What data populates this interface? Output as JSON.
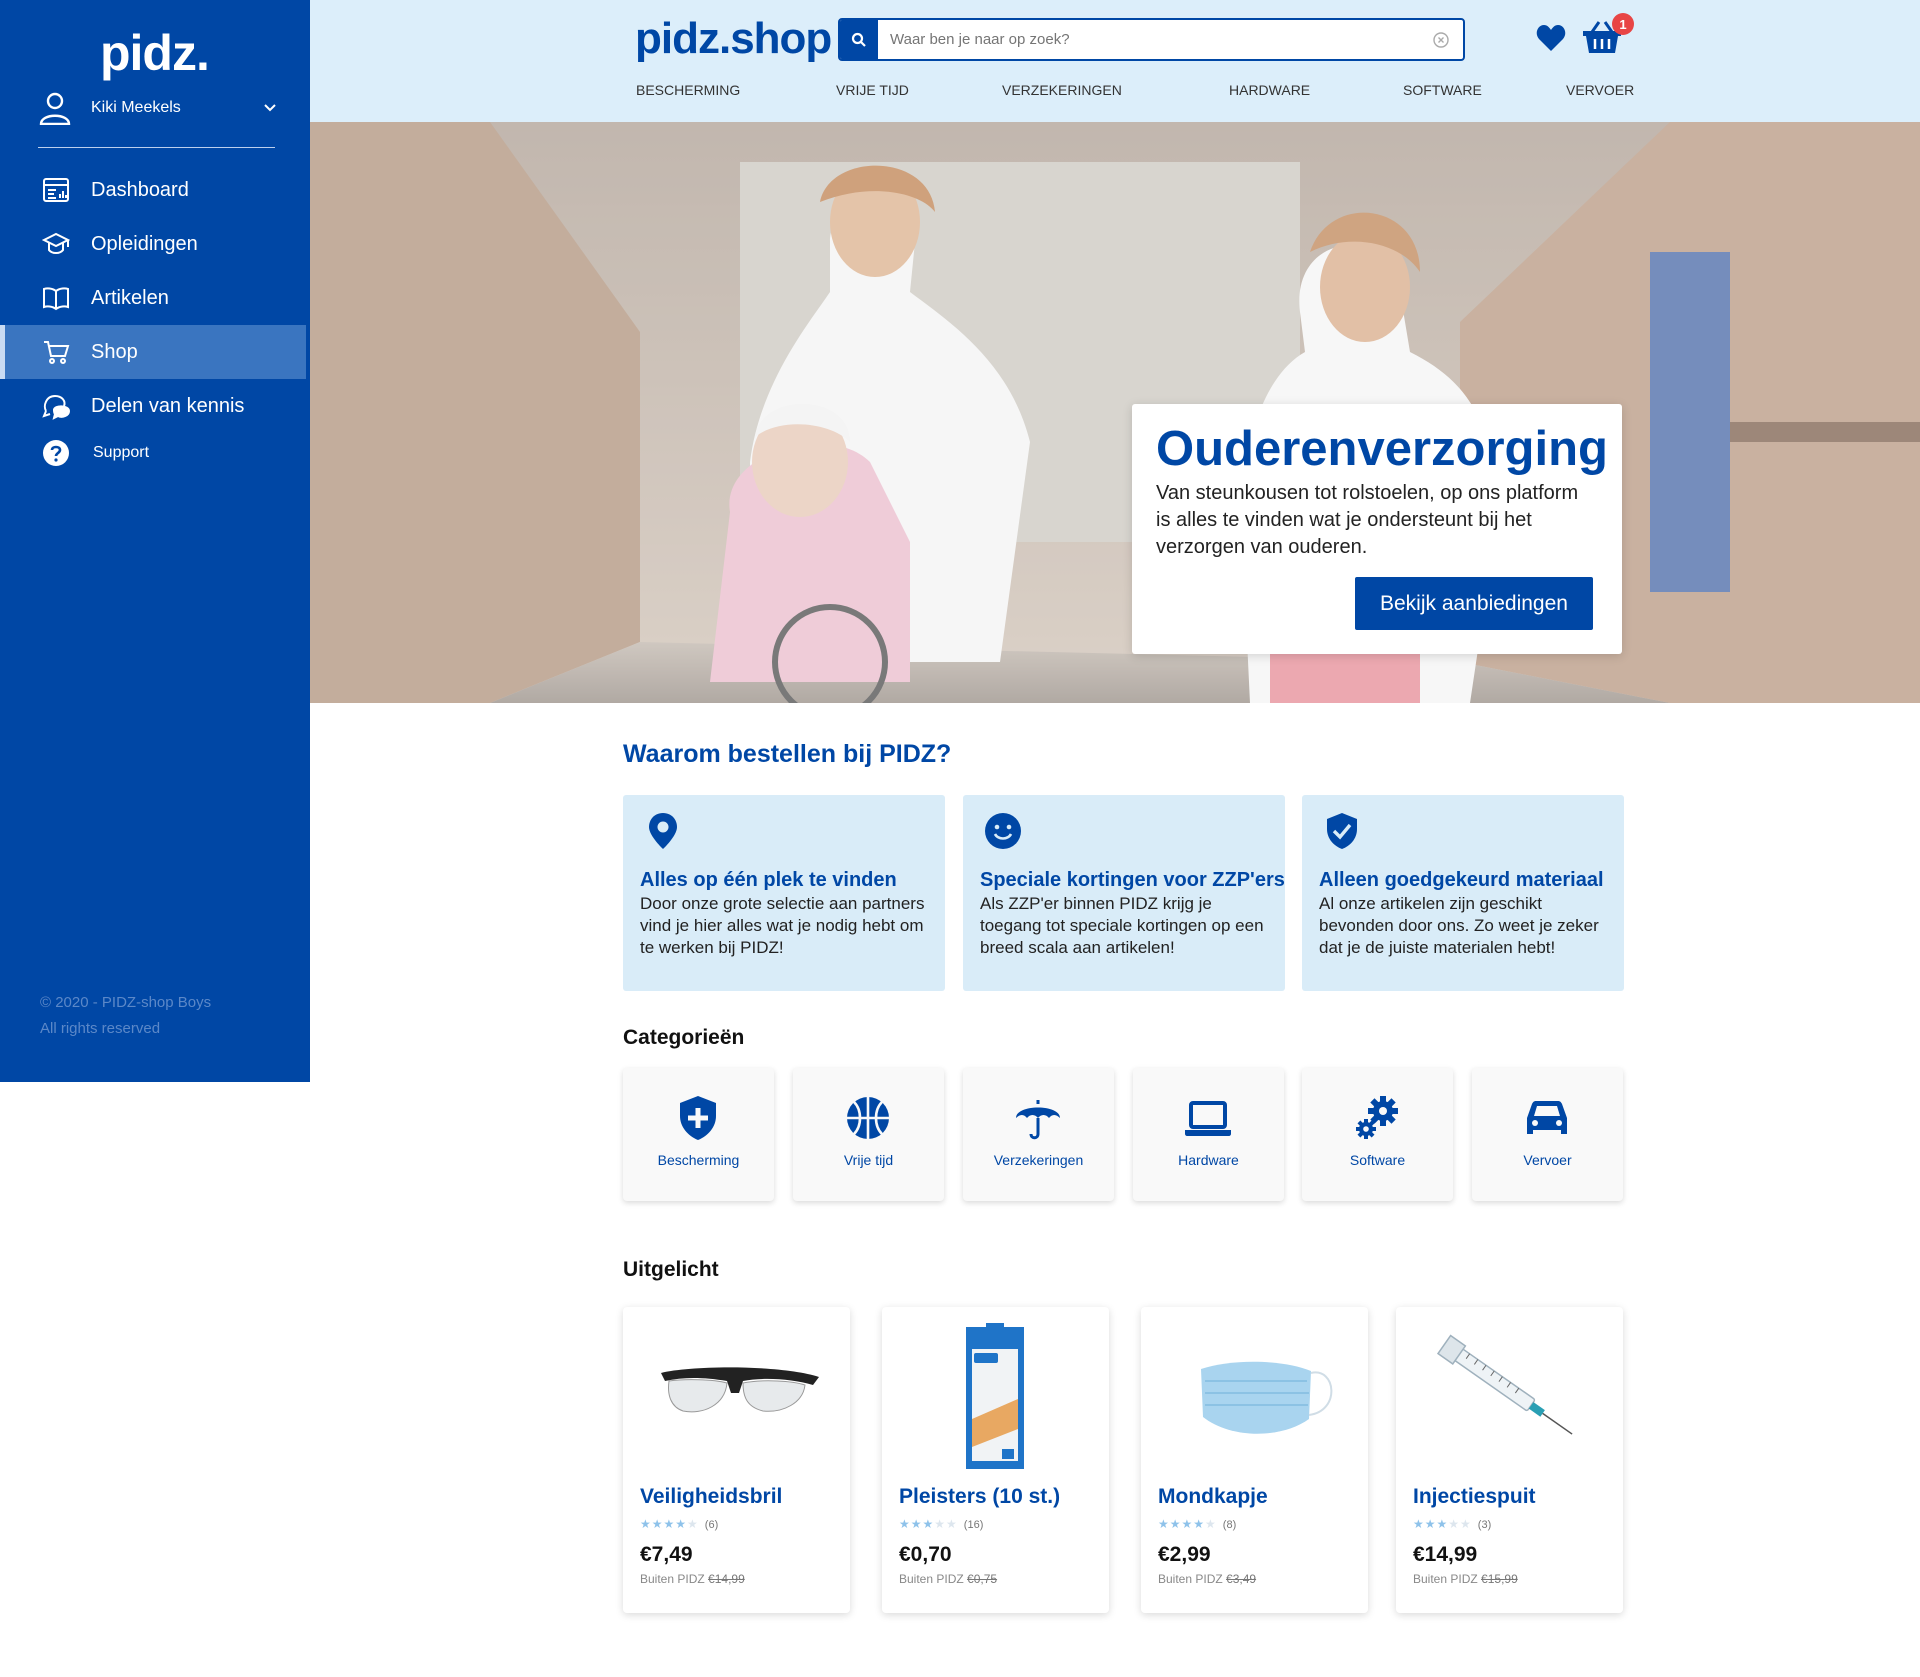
{
  "sidebar": {
    "logo": "pidz.",
    "user_name": "Kiki Meekels",
    "nav": [
      {
        "label": "Dashboard",
        "icon": "dashboard-icon"
      },
      {
        "label": "Opleidingen",
        "icon": "graduation-cap-icon"
      },
      {
        "label": "Artikelen",
        "icon": "book-icon"
      },
      {
        "label": "Shop",
        "icon": "cart-icon",
        "active": true
      },
      {
        "label": "Delen van kennis",
        "icon": "chat-icon"
      },
      {
        "label": "Support",
        "icon": "question-icon"
      }
    ],
    "footer_line1": "© 2020 - PIDZ-shop Boys",
    "footer_line2": "All rights reserved"
  },
  "header": {
    "logo": "pidz.shop",
    "search_placeholder": "Waar ben je naar op zoek?",
    "cart_count": "1",
    "categories": [
      "Bescherming",
      "Vrije tijd",
      "Verzekeringen",
      "Hardware",
      "Software",
      "Vervoer"
    ]
  },
  "hero": {
    "title": "Ouderenverzorging",
    "text": "Van steunkousen tot rolstoelen, op ons platform is alles te vinden wat je ondersteunt bij het verzorgen van ouderen.",
    "cta": "Bekijk aanbiedingen"
  },
  "why": {
    "title": "Waarom bestellen bij PIDZ?",
    "cards": [
      {
        "title": "Alles op één plek te vinden",
        "text": "Door onze grote selectie aan partners vind je hier alles wat je nodig hebt om te werken bij PIDZ!",
        "icon": "location-pin-icon"
      },
      {
        "title": "Speciale kortingen voor ZZP'ers",
        "text": "Als ZZP'er binnen PIDZ krijg je toegang tot speciale kortingen op een breed scala aan artikelen!",
        "icon": "smiley-icon"
      },
      {
        "title": "Alleen goedgekeurd materiaal",
        "text": "Al onze artikelen zijn geschikt bevonden door ons. Zo weet je zeker dat je de juiste materialen hebt!",
        "icon": "shield-check-icon"
      }
    ]
  },
  "categories": {
    "title": "Categorieën",
    "items": [
      {
        "label": "Bescherming",
        "icon": "shield-plus-icon"
      },
      {
        "label": "Vrije tijd",
        "icon": "basketball-icon"
      },
      {
        "label": "Verzekeringen",
        "icon": "umbrella-icon"
      },
      {
        "label": "Hardware",
        "icon": "laptop-icon"
      },
      {
        "label": "Software",
        "icon": "gears-icon"
      },
      {
        "label": "Vervoer",
        "icon": "car-icon"
      }
    ]
  },
  "featured": {
    "title": "Uitgelicht",
    "outside_label": "Buiten PIDZ",
    "products": [
      {
        "name": "Veiligheidsbril",
        "rating": 4,
        "reviews": "(6)",
        "price": "€7,49",
        "old_price": "€14,99",
        "image": "safety-glasses"
      },
      {
        "name": "Pleisters (10 st.)",
        "rating": 3,
        "reviews": "(16)",
        "price": "€0,70",
        "old_price": "€0,75",
        "image": "plasters-box"
      },
      {
        "name": "Mondkapje",
        "rating": 4,
        "reviews": "(8)",
        "price": "€2,99",
        "old_price": "€3,49",
        "image": "face-mask"
      },
      {
        "name": "Injectiespuit",
        "rating": 3,
        "reviews": "(3)",
        "price": "€14,99",
        "old_price": "€15,99",
        "image": "syringe"
      }
    ]
  },
  "colors": {
    "brand": "#0047a5",
    "header_bg": "#dceefa",
    "card_bg": "#d9ecf8",
    "badge": "#e84545"
  }
}
